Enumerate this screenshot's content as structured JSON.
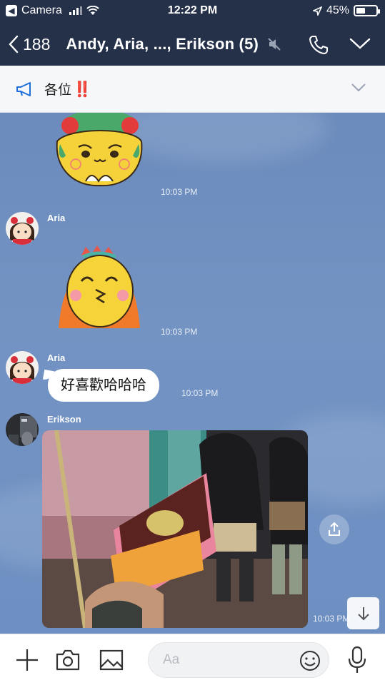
{
  "status_bar": {
    "carrier_back": "Camera",
    "time": "12:22 PM",
    "battery": "45%",
    "battery_level": 0.45
  },
  "header": {
    "back_count": "188",
    "title": "Andy, Aria, ..., Erikson (5)"
  },
  "announcement": {
    "text": "各位",
    "emphasis": "‼️"
  },
  "messages": [
    {
      "type": "sticker",
      "sticker": "girl-with-flower-crown-shy",
      "time": "10:03 PM"
    },
    {
      "type": "sticker",
      "sender": "Aria",
      "sticker": "yellow-bird-laughing",
      "time": "10:03 PM"
    },
    {
      "type": "text",
      "sender": "Aria",
      "text": "好喜歡哈哈哈",
      "time": "10:03 PM"
    },
    {
      "type": "photo",
      "sender": "Erikson",
      "photo": "hand-holding-snack-box-street",
      "time": "10:03 PM"
    }
  ],
  "input_bar": {
    "placeholder": "Aa"
  },
  "colors": {
    "header_bg": "#253049",
    "chat_bg": "#6f8fbf",
    "accent": "#1e6fd9",
    "alert": "#e21b1b"
  }
}
